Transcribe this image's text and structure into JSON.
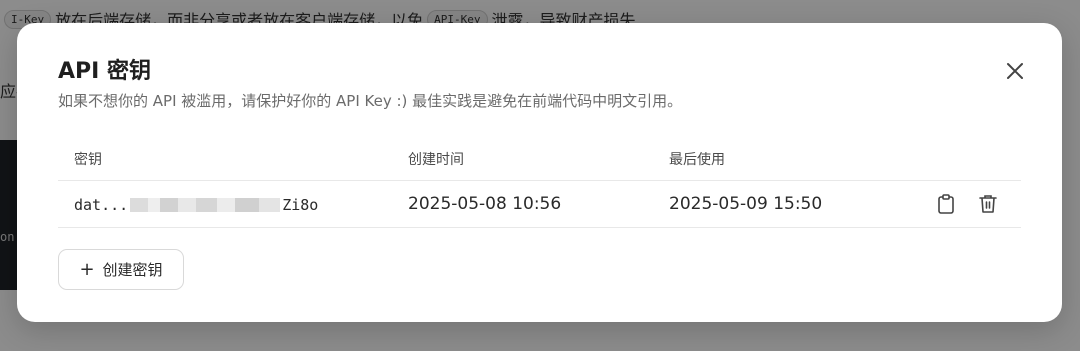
{
  "background": {
    "line_text_1": "I-Key",
    "line_text_2": "放在后端存储，而非分享或者放在客户端存储，以免",
    "line_code": "API-Key",
    "line_text_3": "泄露，导致财产损失",
    "left_text": "应存",
    "dark_text": "on:"
  },
  "modal": {
    "title": "API 密钥",
    "description": "如果不想你的 API 被滥用，请保护好你的 API Key :) 最佳实践是避免在前端代码中明文引用。",
    "columns": {
      "key": "密钥",
      "created": "创建时间",
      "last_used": "最后使用"
    },
    "rows": [
      {
        "key_prefix": "dat...",
        "key_suffix": "Zi8o",
        "created": "2025-05-08 10:56",
        "last_used": "2025-05-09 15:50"
      }
    ],
    "create_button_label": "创建密钥"
  },
  "icons": {
    "close": "close-icon",
    "copy": "clipboard-icon",
    "delete": "trash-icon",
    "plus": "plus-icon"
  },
  "colors": {
    "title": "#1f1f1f",
    "muted": "#6b6b6b",
    "border": "#e8e8e8"
  }
}
